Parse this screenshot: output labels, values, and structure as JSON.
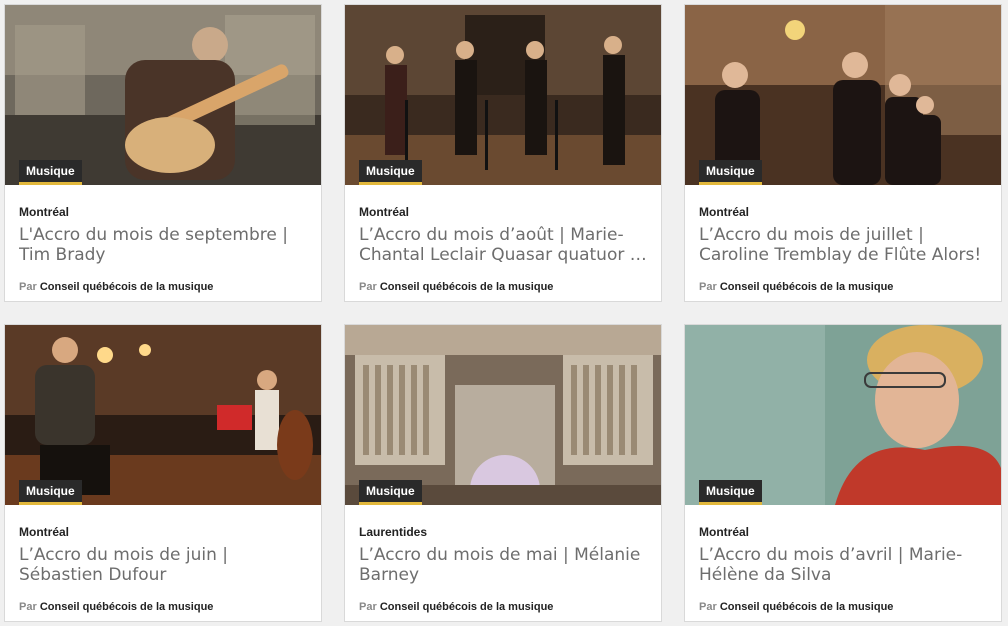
{
  "cards": [
    {
      "category": "Musique",
      "region": "Montréal",
      "title": "L'Accro du mois de septembre | Tim Brady",
      "by_prefix": "Par",
      "author": "Conseil québécois de la musique",
      "thumb_colors": [
        "#3b3a36",
        "#7a7468",
        "#c9bfae"
      ]
    },
    {
      "category": "Musique",
      "region": "Montréal",
      "title": "L’Accro du mois d’août | Marie-Chantal Leclair Quasar quatuor …",
      "by_prefix": "Par",
      "author": "Conseil québécois de la musique",
      "thumb_colors": [
        "#2b1d15",
        "#5a3a26",
        "#8a6a4a"
      ]
    },
    {
      "category": "Musique",
      "region": "Montréal",
      "title": "L’Accro du mois de juillet | Caroline Tremblay de Flûte Alors!",
      "by_prefix": "Par",
      "author": "Conseil québécois de la musique",
      "thumb_colors": [
        "#3a2418",
        "#7a5236",
        "#c79a68"
      ]
    },
    {
      "category": "Musique",
      "region": "Montréal",
      "title": "L’Accro du mois de juin | Sébastien Dufour",
      "by_prefix": "Par",
      "author": "Conseil québécois de la musique",
      "thumb_colors": [
        "#1f1610",
        "#5a3220",
        "#a8612e"
      ]
    },
    {
      "category": "Musique",
      "region": "Laurentides",
      "title": "L’Accro du mois de mai | Mélanie Barney",
      "by_prefix": "Par",
      "author": "Conseil québécois de la musique",
      "thumb_colors": [
        "#5a4a3c",
        "#9a8a7a",
        "#d8cfc4"
      ]
    },
    {
      "category": "Musique",
      "region": "Montréal",
      "title": "L’Accro du mois d’avril | Marie-Hélène da Silva",
      "by_prefix": "Par",
      "author": "Conseil québécois de la musique",
      "thumb_colors": [
        "#5f8a80",
        "#8db0a6",
        "#c33a2a"
      ]
    }
  ]
}
